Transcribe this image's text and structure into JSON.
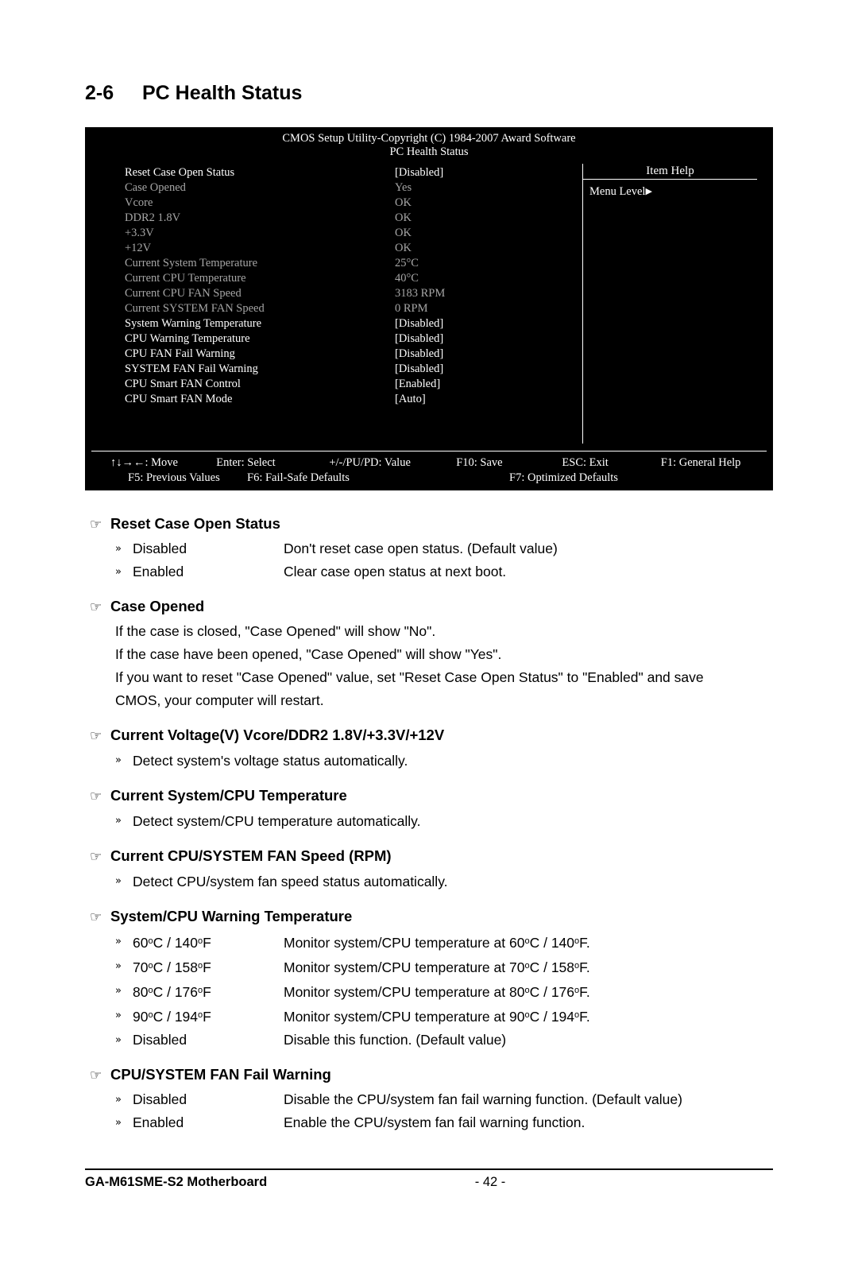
{
  "chapter": {
    "number": "2-6",
    "title": "PC Health Status"
  },
  "bios": {
    "header_line1": "CMOS Setup Utility-Copyright (C) 1984-2007 Award Software",
    "header_line2": "PC Health Status",
    "item_help_title": "Item Help",
    "menu_level": "Menu Level",
    "rows": [
      {
        "label": "Reset Case Open Status",
        "value": "[Disabled]",
        "style": "bright"
      },
      {
        "label": "Case Opened",
        "value": "Yes",
        "style": "dim"
      },
      {
        "label": "Vcore",
        "value": "OK",
        "style": "dim"
      },
      {
        "label": "DDR2 1.8V",
        "value": "OK",
        "style": "dim"
      },
      {
        "label": "+3.3V",
        "value": "OK",
        "style": "dim"
      },
      {
        "label": "+12V",
        "value": "OK",
        "style": "dim"
      },
      {
        "label": "Current System Temperature",
        "value": "25°C",
        "style": "dim"
      },
      {
        "label": "Current CPU Temperature",
        "value": "40°C",
        "style": "dim"
      },
      {
        "label": "Current CPU FAN Speed",
        "value": "3183 RPM",
        "style": "dim"
      },
      {
        "label": "Current SYSTEM FAN Speed",
        "value": "0     RPM",
        "style": "dim"
      },
      {
        "label": "System Warning Temperature",
        "value": "[Disabled]",
        "style": "bright"
      },
      {
        "label": "CPU Warning Temperature",
        "value": "[Disabled]",
        "style": "bright"
      },
      {
        "label": "CPU FAN Fail Warning",
        "value": "[Disabled]",
        "style": "bright"
      },
      {
        "label": "SYSTEM FAN Fail Warning",
        "value": "[Disabled]",
        "style": "bright"
      },
      {
        "label": "CPU Smart FAN Control",
        "value": "[Enabled]",
        "style": "bright"
      },
      {
        "label": "CPU Smart FAN Mode",
        "value": "[Auto]",
        "style": "bright"
      }
    ],
    "footer": {
      "move": "↑↓→←: Move",
      "enter": "Enter: Select",
      "value": "+/-/PU/PD: Value",
      "save": "F10: Save",
      "exit": "ESC: Exit",
      "help": "F1: General Help",
      "prev": "F5: Previous Values",
      "failsafe": "F6: Fail-Safe Defaults",
      "optimized": "F7: Optimized Defaults"
    }
  },
  "sections": [
    {
      "title": "Reset Case Open Status",
      "options": [
        {
          "label": "Disabled",
          "desc": "Don't reset case open status. (Default value)"
        },
        {
          "label": "Enabled",
          "desc": "Clear case open status at next boot."
        }
      ]
    },
    {
      "title": "Case Opened",
      "lines": [
        "If the case is closed, \"Case Opened\" will show \"No\".",
        "If the case have been opened, \"Case Opened\" will show \"Yes\".",
        "If you want to reset \"Case Opened\" value, set \"Reset Case Open Status\" to \"Enabled\" and save",
        "CMOS, your computer will restart."
      ]
    },
    {
      "title": "Current Voltage(V) Vcore/DDR2 1.8V/+3.3V/+12V",
      "bullets": [
        "Detect system's voltage status automatically."
      ]
    },
    {
      "title": "Current System/CPU Temperature",
      "bullets": [
        "Detect system/CPU temperature automatically."
      ]
    },
    {
      "title": "Current CPU/SYSTEM FAN Speed (RPM)",
      "bullets": [
        "Detect CPU/system fan speed status automatically."
      ]
    },
    {
      "title": "System/CPU Warning Temperature",
      "temp_options": [
        {
          "c": "60",
          "f": "140",
          "desc_c": "60",
          "desc_f": "140"
        },
        {
          "c": "70",
          "f": "158",
          "desc_c": "70",
          "desc_f": "158"
        },
        {
          "c": "80",
          "f": "176",
          "desc_c": "80",
          "desc_f": "176"
        },
        {
          "c": "90",
          "f": "194",
          "desc_c": "90",
          "desc_f": "194"
        }
      ],
      "disabled_option": {
        "label": "Disabled",
        "desc": "Disable this function. (Default value)"
      }
    },
    {
      "title": "CPU/SYSTEM FAN Fail Warning",
      "options": [
        {
          "label": "Disabled",
          "desc": "Disable the CPU/system fan fail warning function. (Default value)"
        },
        {
          "label": "Enabled",
          "desc": "Enable the CPU/system fan fail warning function."
        }
      ]
    }
  ],
  "footer": {
    "product": "GA-M61SME-S2 Motherboard",
    "page": "- 42 -"
  }
}
